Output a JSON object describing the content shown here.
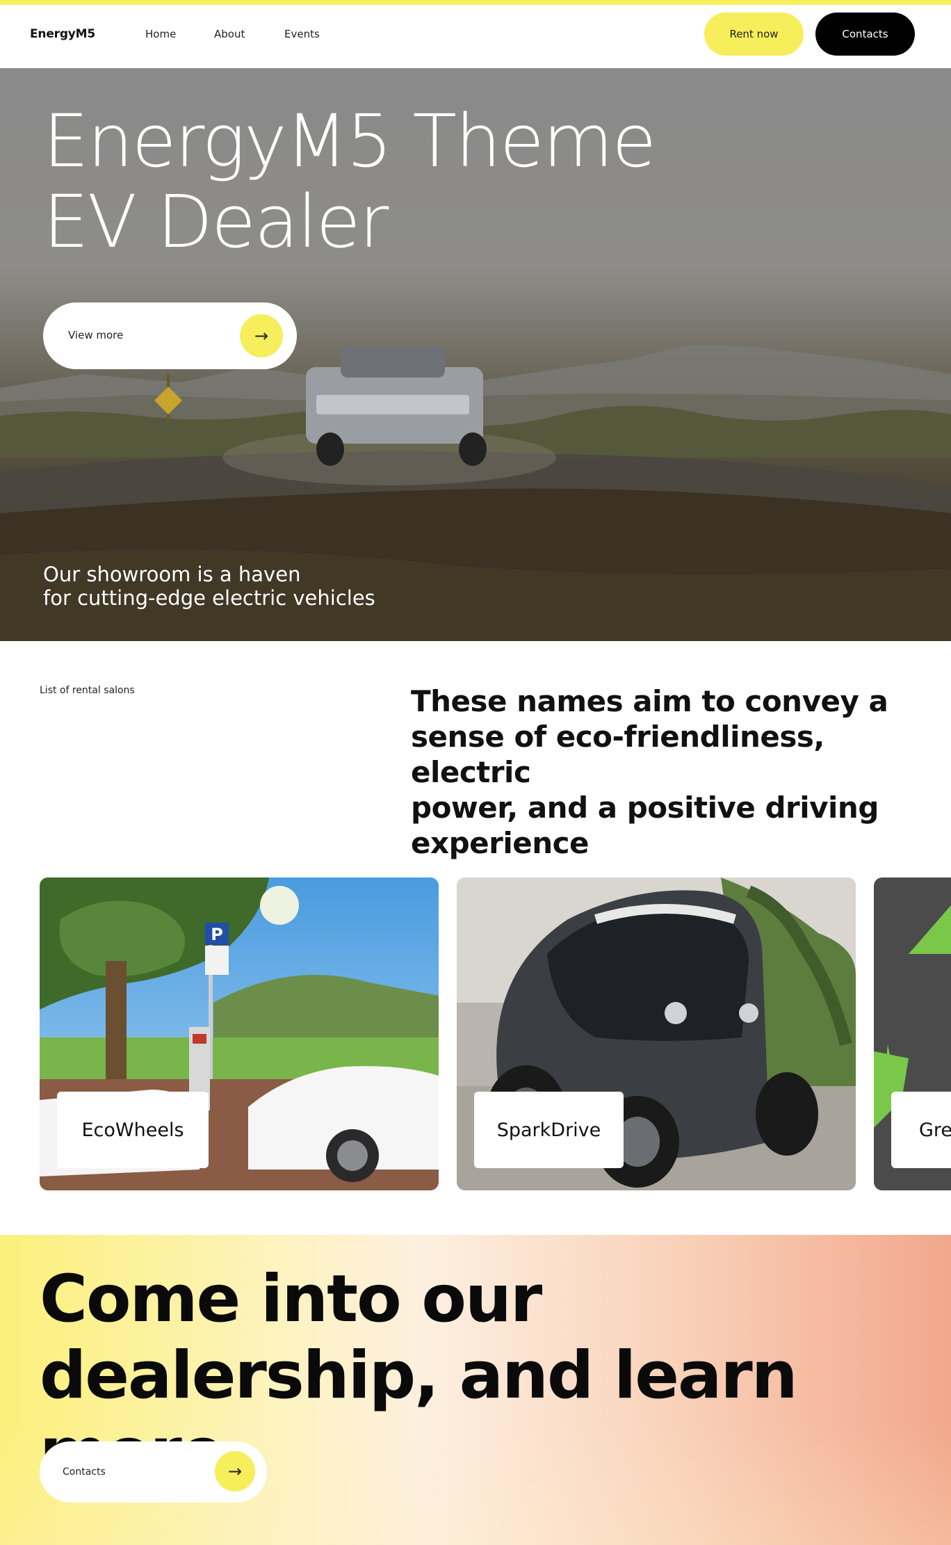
{
  "header": {
    "brand": "EnergyM5",
    "nav": [
      {
        "label": "Home"
      },
      {
        "label": "About"
      },
      {
        "label": "Events"
      }
    ],
    "rent_label": "Rent now",
    "contacts_label": "Contacts"
  },
  "hero": {
    "title_line1": "EnergyM5 Theme",
    "title_line2": "EV Dealer",
    "view_more_label": "View more",
    "arrow": "→",
    "subtitle_line1": "Our showroom is a haven",
    "subtitle_line2": "for cutting-edge electric vehicles"
  },
  "salons": {
    "label": "List of rental salons",
    "heading_line1": "These names aim to convey a",
    "heading_line2": "sense of eco-friendliness, electric",
    "heading_line3": "power, and a positive driving",
    "heading_line4": "experience",
    "cards": [
      {
        "name": "EcoWheels"
      },
      {
        "name": "SparkDrive"
      },
      {
        "name": "Gre"
      }
    ]
  },
  "cta": {
    "title_line1": "Come into our",
    "title_line2": "dealership, and learn more",
    "button_label": "Contacts",
    "arrow": "→"
  },
  "colors": {
    "accent_yellow": "#f6ee5a",
    "black": "#000000"
  }
}
